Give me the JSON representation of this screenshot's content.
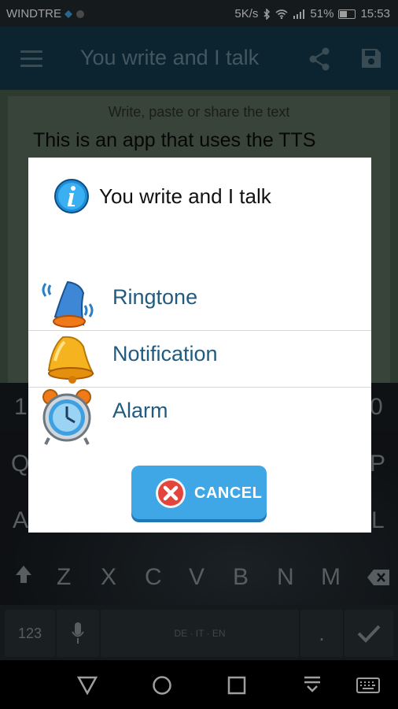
{
  "status_bar": {
    "carrier": "WINDTRE",
    "speed": "5K/s",
    "battery": "51%",
    "time": "15:53"
  },
  "app_bar": {
    "title": "You write and I talk",
    "icons": [
      "menu-icon",
      "share-icon",
      "save-icon"
    ]
  },
  "content": {
    "hint": "Write, paste or share the text",
    "text": "This is an app that uses the TTS"
  },
  "keyboard": {
    "row_numbers_visible": [
      "1",
      "0"
    ],
    "row_top_visible": [
      "Q",
      "P"
    ],
    "row_middle_visible": [
      "A",
      "L"
    ],
    "row_bottom": [
      "Z",
      "X",
      "C",
      "V",
      "B",
      "N",
      "M"
    ],
    "symbols_key": "123",
    "period_key": ".",
    "space_label": "DE · IT · EN"
  },
  "dialog": {
    "title": "You write and I talk",
    "options": [
      {
        "label": "Ringtone",
        "icon": "bell-ringing-icon"
      },
      {
        "label": "Notification",
        "icon": "bell-icon"
      },
      {
        "label": "Alarm",
        "icon": "alarm-clock-icon"
      }
    ],
    "cancel_label": "CANCEL"
  },
  "colors": {
    "app_bar": "#123a4c",
    "dialog_option_text": "#215b80",
    "cancel_button": "#3fa7e6"
  }
}
